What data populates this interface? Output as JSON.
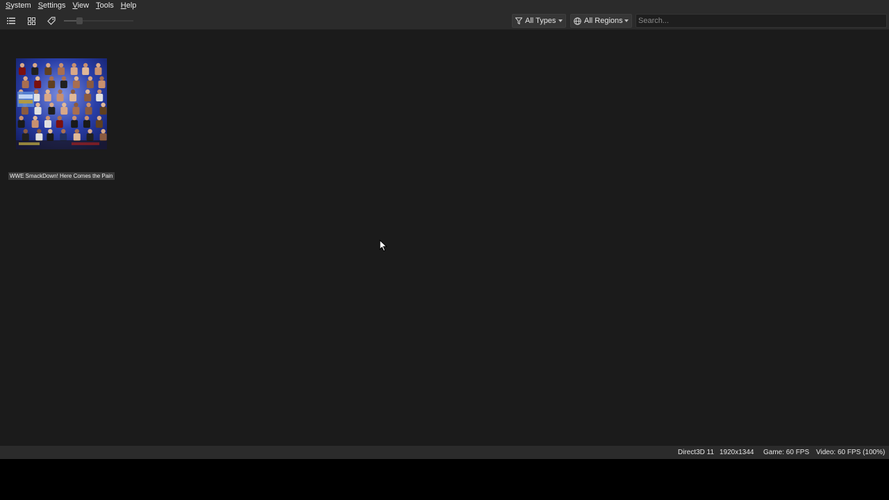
{
  "menu": {
    "items": [
      {
        "mnemonic": "S",
        "rest": "ystem"
      },
      {
        "mnemonic": "S",
        "rest": "ettings"
      },
      {
        "mnemonic": "V",
        "rest": "iew"
      },
      {
        "mnemonic": "T",
        "rest": "ools"
      },
      {
        "mnemonic": "H",
        "rest": "elp"
      }
    ]
  },
  "toolbar": {
    "list_view_icon": "list-icon",
    "grid_view_icon": "grid-icon",
    "tag_icon": "tag-icon",
    "zoom_level": 0.2,
    "type_filter": "All Types",
    "region_filter": "All Regions",
    "search_placeholder": "Search..."
  },
  "games": [
    {
      "title": "WWE SmackDown! Here Comes the Pain"
    }
  ],
  "status": {
    "renderer": "Direct3D 11",
    "resolution": "1920x1344",
    "game_fps": "Game: 60 FPS",
    "video_fps": "Video: 60 FPS (100%)"
  },
  "colors": {
    "window_bg": "#1b1b1b",
    "bar_bg": "#2b2b2b",
    "cover_blue": "#2a3fa8"
  }
}
